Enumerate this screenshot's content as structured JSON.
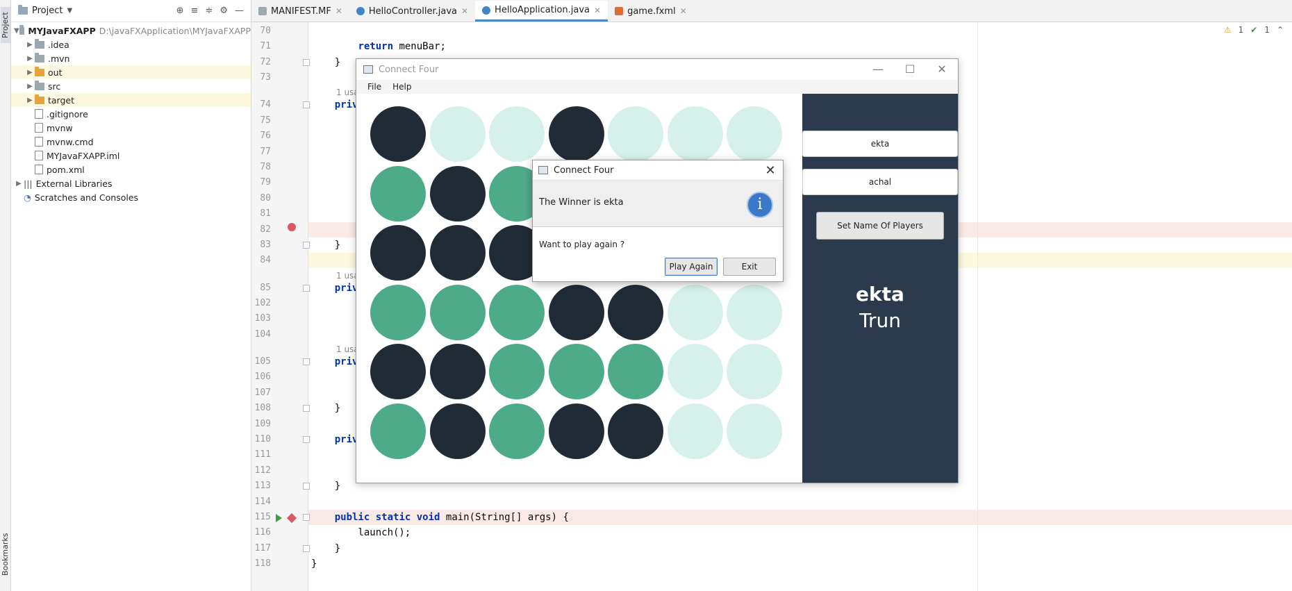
{
  "sidebar_strip": {
    "project_label": "Project",
    "bookmarks_label": "Bookmarks"
  },
  "project_panel": {
    "title": "Project",
    "header_icons": [
      "target-icon",
      "expand-all-icon",
      "collapse-all-icon",
      "gear-icon",
      "minimize-icon"
    ],
    "root": {
      "name": "MYJavaFXAPP",
      "path": "D:\\javaFXApplication\\MYJavaFXAPP"
    },
    "items": [
      {
        "label": ".idea",
        "type": "folder"
      },
      {
        "label": ".mvn",
        "type": "folder"
      },
      {
        "label": "out",
        "type": "folder-excluded"
      },
      {
        "label": "src",
        "type": "folder"
      },
      {
        "label": "target",
        "type": "folder-excluded"
      },
      {
        "label": ".gitignore",
        "type": "file"
      },
      {
        "label": "mvnw",
        "type": "file"
      },
      {
        "label": "mvnw.cmd",
        "type": "file"
      },
      {
        "label": "MYJavaFXAPP.iml",
        "type": "file"
      },
      {
        "label": "pom.xml",
        "type": "file"
      }
    ],
    "external_libraries": "External Libraries",
    "scratches": "Scratches and Consoles"
  },
  "tabs": [
    {
      "label": "MANIFEST.MF",
      "icon": "manifest-icon",
      "active": false
    },
    {
      "label": "HelloController.java",
      "icon": "java-class-icon",
      "active": false
    },
    {
      "label": "HelloApplication.java",
      "icon": "java-class-icon",
      "active": true
    },
    {
      "label": "game.fxml",
      "icon": "fxml-icon",
      "active": false
    }
  ],
  "inspections": {
    "warnings": "1",
    "ok": "1"
  },
  "editor": {
    "lines": [
      {
        "n": "70",
        "code": ""
      },
      {
        "n": "71",
        "code": "        return menuBar;"
      },
      {
        "n": "72",
        "code": "    }"
      },
      {
        "n": "73",
        "code": ""
      },
      {
        "n": "74",
        "code": "    priv"
      },
      {
        "n": "75",
        "code": ""
      },
      {
        "n": "76",
        "code": ""
      },
      {
        "n": "77",
        "code": ""
      },
      {
        "n": "78",
        "code": ""
      },
      {
        "n": "79",
        "code": ""
      },
      {
        "n": "80",
        "code": ""
      },
      {
        "n": "81",
        "code": ""
      },
      {
        "n": "82",
        "code": ""
      },
      {
        "n": "83",
        "code": "    }"
      },
      {
        "n": "84",
        "code": ""
      },
      {
        "n": "85",
        "code": "    priv"
      },
      {
        "n": "102",
        "code": ""
      },
      {
        "n": "103",
        "code": ""
      },
      {
        "n": "104",
        "code": ""
      },
      {
        "n": "105",
        "code": "    priv"
      },
      {
        "n": "106",
        "code": ""
      },
      {
        "n": "107",
        "code": ""
      },
      {
        "n": "108",
        "code": "    }"
      },
      {
        "n": "109",
        "code": ""
      },
      {
        "n": "110",
        "code": "    priv"
      },
      {
        "n": "111",
        "code": ""
      },
      {
        "n": "112",
        "code": ""
      },
      {
        "n": "113",
        "code": "    }"
      },
      {
        "n": "114",
        "code": ""
      },
      {
        "n": "115",
        "code": "    public static void main(String[] args) {"
      },
      {
        "n": "116",
        "code": "        launch();"
      },
      {
        "n": "117",
        "code": "    }"
      },
      {
        "n": "118",
        "code": "}"
      }
    ],
    "usage_hint": "1 usag"
  },
  "connect_four": {
    "window_title": "Connect Four",
    "menu": [
      "File",
      "Help"
    ],
    "board": [
      [
        "dark",
        "empty",
        "empty",
        "dark",
        "empty",
        "empty",
        "empty"
      ],
      [
        "green",
        "dark",
        "green",
        "empty",
        "empty",
        "empty",
        "empty"
      ],
      [
        "dark",
        "dark",
        "dark",
        "empty",
        "empty",
        "empty",
        "empty"
      ],
      [
        "green",
        "green",
        "green",
        "dark",
        "dark",
        "empty",
        "empty"
      ],
      [
        "dark",
        "dark",
        "green",
        "green",
        "green",
        "empty",
        "empty"
      ],
      [
        "green",
        "dark",
        "green",
        "dark",
        "dark",
        "empty",
        "empty"
      ]
    ],
    "player1_name": "ekta",
    "player2_name": "achal",
    "set_names_button": "Set Name Of Players",
    "current_player": "ekta",
    "turn_label": "Trun",
    "colors": {
      "dark": "#212b36",
      "green": "#4eab89",
      "empty": "#d6f1ec",
      "side_panel": "#2b3b4d"
    }
  },
  "dialog": {
    "title": "Connect Four",
    "header": "The Winner is ekta",
    "content": "Want to play again ?",
    "play_again": "Play Again",
    "exit": "Exit"
  }
}
